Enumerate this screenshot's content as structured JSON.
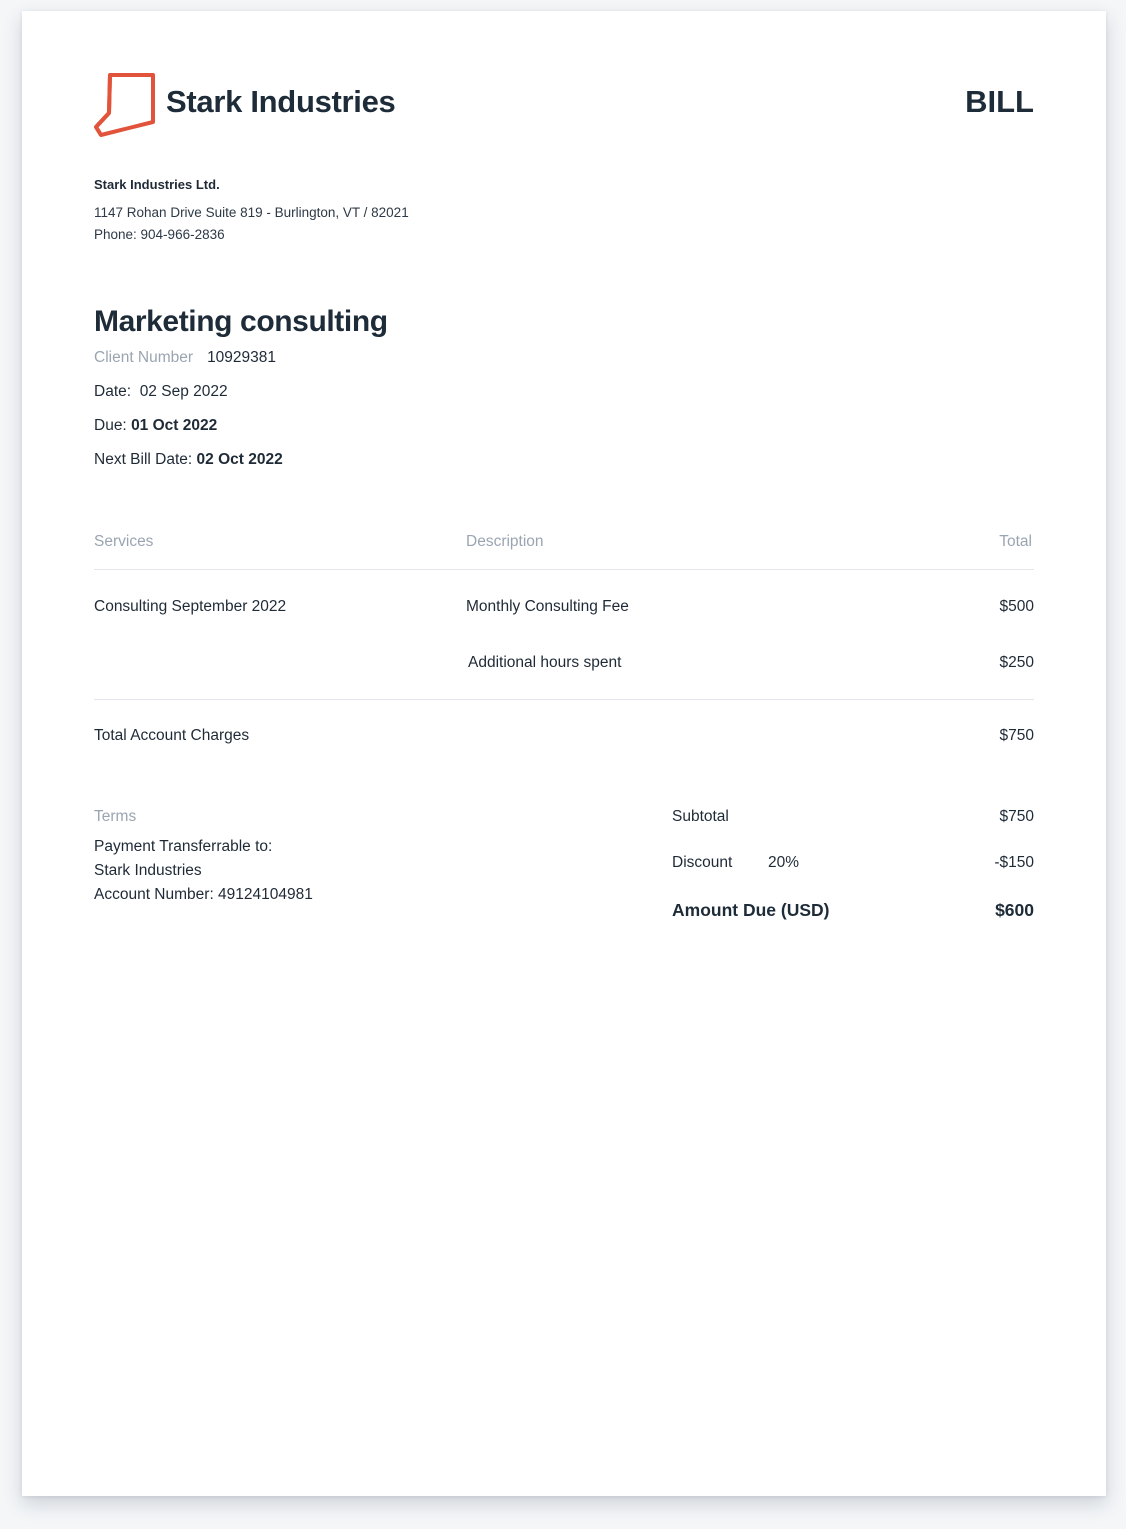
{
  "colors": {
    "brand_accent": "#e2533c",
    "text_dark": "#1e2b38",
    "text_muted": "#9aa5b1",
    "divider": "#e3e7eb"
  },
  "header": {
    "logo_icon": "folded-page-logo-icon",
    "brand_name": "Stark Industries",
    "doc_type": "BILL"
  },
  "sender": {
    "company": "Stark Industries Ltd.",
    "address": "1147 Rohan Drive Suite 819 - Burlington, VT / 82021",
    "phone": "Phone: 904-966-2836"
  },
  "bill": {
    "title": "Marketing consulting",
    "client_number_label": "Client Number",
    "client_number": "10929381",
    "date_label": "Date:",
    "date": "02 Sep 2022",
    "due_label": "Due:",
    "due": "01 Oct 2022",
    "next_label": "Next Bill Date:",
    "next": "02 Oct 2022"
  },
  "table": {
    "headers": {
      "services": "Services",
      "description": "Description",
      "total": "Total"
    },
    "rows": [
      {
        "service": "Consulting September 2022",
        "description": "Monthly Consulting Fee",
        "total": "$500"
      },
      {
        "service": "",
        "description": "Additional hours spent",
        "total": "$250"
      }
    ],
    "total_label": "Total Account Charges",
    "total_value": "$750"
  },
  "terms": {
    "label": "Terms",
    "lines": [
      "Payment Transferrable to:",
      "Stark Industries",
      "Account Number: 49124104981"
    ]
  },
  "summary": {
    "subtotal_label": "Subtotal",
    "subtotal_value": "$750",
    "discount_label": "Discount",
    "discount_pct": "20%",
    "discount_value": "-$150",
    "amount_due_label": "Amount Due (USD)",
    "amount_due_value": "$600"
  }
}
